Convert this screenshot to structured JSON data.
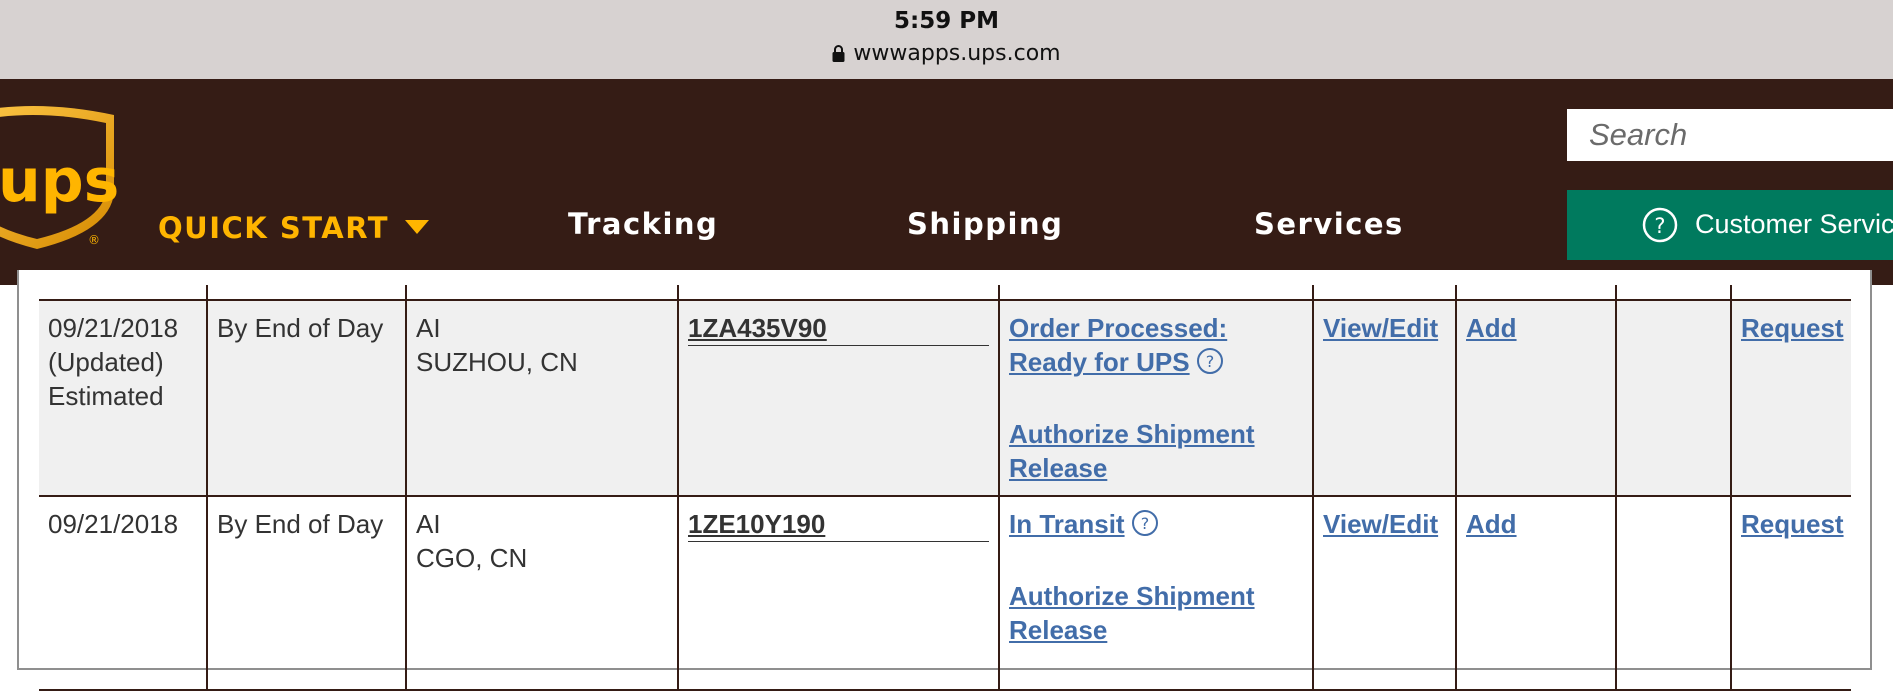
{
  "status_bar": {
    "time": "5:59 PM",
    "url": "wwwapps.ups.com",
    "lock_icon": "lock-icon"
  },
  "header": {
    "logo_text": "ups",
    "nav": {
      "quick_start": "QUICK START",
      "tracking": "Tracking",
      "shipping": "Shipping",
      "services": "Services"
    },
    "search_placeholder": "Search",
    "customer_service": "Customer Service",
    "colors": {
      "brown": "#351c15",
      "gold": "#ffb500",
      "green": "#007a5e"
    }
  },
  "shipments": [
    {
      "date_lines": [
        "09/21/2018",
        "(Updated)",
        "Estimated"
      ],
      "delivery": "By End of Day",
      "carrier": "AI",
      "location": "SUZHOU, CN",
      "tracking_number": "1ZA435V90",
      "status_lines": [
        "Order Processed:",
        "Ready for UPS"
      ],
      "authorize_lines": [
        "Authorize Shipment",
        "Release"
      ],
      "view_edit": "View/Edit",
      "add": "Add",
      "request": "Request"
    },
    {
      "date_lines": [
        "09/21/2018"
      ],
      "delivery": "By End of Day",
      "carrier": "AI",
      "location": "CGO, CN",
      "tracking_number": "1ZE10Y190",
      "status_lines": [
        "In Transit"
      ],
      "authorize_lines": [
        "Authorize Shipment",
        "Release"
      ],
      "view_edit": "View/Edit",
      "add": "Add",
      "request": "Request"
    }
  ],
  "link_color": "#426da9"
}
